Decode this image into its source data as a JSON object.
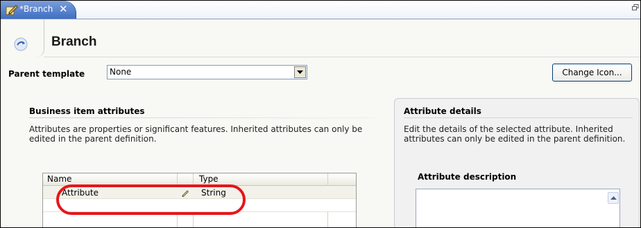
{
  "tab": {
    "label": "*Branch",
    "close_glyph": "✕",
    "icon": "pencil-edit-icon"
  },
  "header": {
    "title": "Branch",
    "icon": "branch-icon"
  },
  "parent_template": {
    "label": "Parent template",
    "value": "None"
  },
  "change_icon_button": "Change Icon...",
  "business_attributes": {
    "title": "Business item attributes",
    "description": "Attributes are properties or significant features. Inherited attributes can only be edited in the parent definition.",
    "columns": [
      "Name",
      "Type"
    ],
    "rows": [
      {
        "name": "Attribute",
        "type": "String",
        "icon": "pencil-icon"
      }
    ]
  },
  "attribute_details": {
    "title": "Attribute details",
    "description": "Edit the details of the selected attribute. Inherited attributes can only be edited in the parent definition.",
    "description_label": "Attribute description"
  },
  "colors": {
    "tab_active": "#3e6fc4",
    "highlight_annotation": "#e8141a",
    "panel_bg": "#f8f8f4"
  }
}
